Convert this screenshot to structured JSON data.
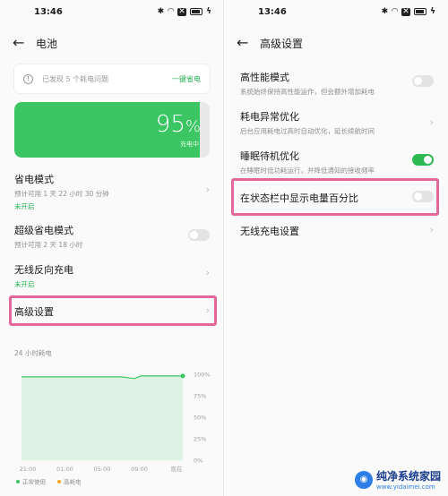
{
  "left": {
    "status": {
      "time": "13:46"
    },
    "header": {
      "title": "电池"
    },
    "notice": {
      "text": "已发现 5 个耗电问题",
      "action": "一键省电"
    },
    "battery": {
      "percent": "95",
      "unit": "%",
      "charging": "充电中",
      "level": 0.95
    },
    "items": [
      {
        "title": "省电模式",
        "sub": "预计可用 1 天 22 小时 30 分钟",
        "status": "未开启"
      },
      {
        "title": "超级省电模式",
        "sub": "预计可用 2 天 18 小时"
      },
      {
        "title": "无线反向充电",
        "status": "未开启"
      },
      {
        "title": "高级设置"
      }
    ],
    "chart_title": "24 小时耗电"
  },
  "chart_data": {
    "type": "area",
    "x": [
      "21:00",
      "01:00",
      "05:00",
      "09:00",
      "现在"
    ],
    "y_ticks": [
      "100%",
      "75%",
      "50%",
      "25%",
      "0%"
    ],
    "ylim": [
      0,
      100
    ],
    "series": [
      {
        "name": "正常使用",
        "color": "#3bc663",
        "points": [
          [
            0,
            97
          ],
          [
            0.25,
            97
          ],
          [
            0.5,
            97
          ],
          [
            0.62,
            97
          ],
          [
            0.7,
            95
          ],
          [
            0.74,
            98
          ],
          [
            0.85,
            98
          ],
          [
            1.0,
            98
          ]
        ]
      }
    ],
    "legend": [
      {
        "label": "正常使用",
        "color": "#3bc663"
      },
      {
        "label": "高耗电",
        "color": "#f5a623"
      }
    ]
  },
  "right": {
    "status": {
      "time": "13:46"
    },
    "header": {
      "title": "高级设置"
    },
    "items": [
      {
        "title": "高性能模式",
        "sub": "系统始终保持高性能运作，但会额外增加耗电"
      },
      {
        "title": "耗电异常优化",
        "sub": "后台应用耗电过高时自动优化，延长续航时间"
      },
      {
        "title": "睡眠待机优化",
        "sub": "在睡眠时低功耗运行，并降低通知的接收频率"
      },
      {
        "title": "在状态栏中显示电量百分比"
      },
      {
        "title": "无线充电设置"
      }
    ]
  },
  "watermark": {
    "name": "纯净系统家园",
    "url": "www.yidaimei.com"
  },
  "colors": {
    "accent": "#27b053",
    "highlight": "#e2679b",
    "toggle_on": "#2fb952"
  }
}
